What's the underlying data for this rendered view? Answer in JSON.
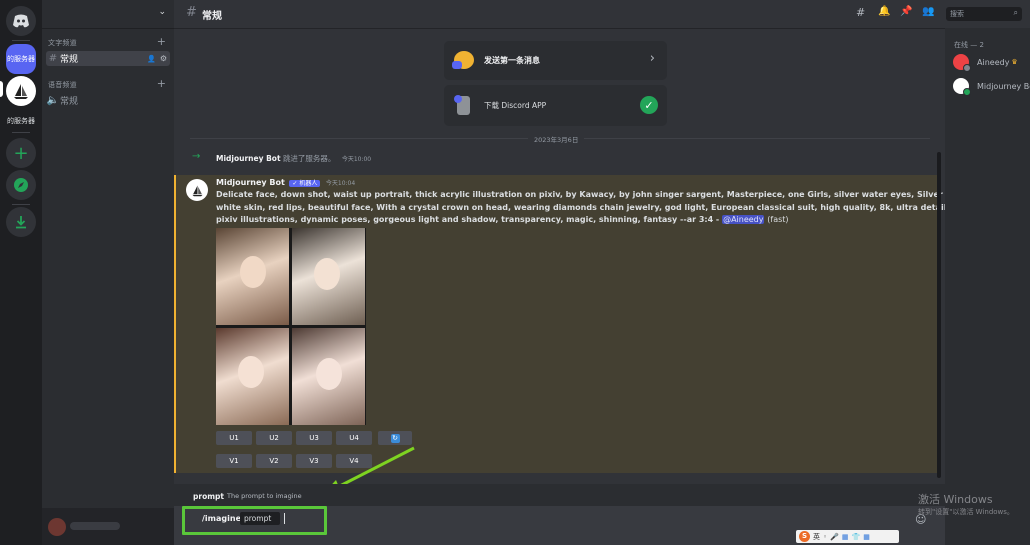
{
  "app": {
    "name": "Discord"
  },
  "servers": [
    {
      "label": "的服务器",
      "color": "#5865f2"
    },
    {
      "label": "的服务器",
      "color": "#ffffff"
    }
  ],
  "rail_icons": [
    "discord-home-icon",
    "add-server-icon",
    "explore-icon",
    "download-icon"
  ],
  "sidebar": {
    "text_category": "文字频道",
    "voice_category": "语音频道",
    "text_channel": "常规",
    "voice_channel": "常规"
  },
  "header": {
    "channel_name": "常规",
    "search_placeholder": "搜索"
  },
  "welcome_cards": [
    {
      "label": "发送第一条消息",
      "trailing": "›"
    },
    {
      "label": "下载 Discord APP",
      "trailing": "✓"
    }
  ],
  "date_divider": "2023年3月6日",
  "join_message": {
    "arrow": "→",
    "author": "Midjourney Bot",
    "text": "跳进了服务器。",
    "time": "今天10:00"
  },
  "bot_message": {
    "author": "Midjourney Bot",
    "badge": "✓ 机器人",
    "time": "今天10:04",
    "prompt_lines": [
      "Delicate face, down shot, waist up portrait, thick acrylic illustration on pixiv, by Kawacy, by john singer sargent, Masterpiece, one Girls, silver water eyes, Silver hair, pale",
      "white skin, red lips, beautiful face, With a crystal crown on head, wearing diamonds chain jewelry, god light, European classical suit, high quality, 8k, ultra detailed, the latest",
      "pixiv illustrations, dynamic poses, gorgeous light and shadow, transparency, magic, shinning, fantasy --ar 3:4 -"
    ],
    "mention": "@Aineedy",
    "speed": "(fast)",
    "upscale_buttons": [
      "U1",
      "U2",
      "U3",
      "U4"
    ],
    "variation_buttons": [
      "V1",
      "V2",
      "V3",
      "V4"
    ],
    "reroll_icon": "refresh-icon"
  },
  "command_hint": {
    "name": "prompt",
    "description": "The prompt to imagine"
  },
  "composer": {
    "command": "/imagine",
    "option": "prompt"
  },
  "members": {
    "header": "在线 — 2",
    "list": [
      {
        "name": "Aineedy",
        "badge": "crown-icon",
        "color": "#ed4245"
      },
      {
        "name": "Midjourney Bot",
        "badge": "",
        "color": "#ffffff"
      }
    ]
  },
  "watermark": {
    "line1": "激活 Windows",
    "line2": "转到\"设置\"以激活 Windows。"
  },
  "ime_toolbar": {
    "logo": "S",
    "lang": "英"
  },
  "colors": {
    "accent": "#5865f2",
    "highlight": "#57f287",
    "arrow_green": "#7ed321",
    "mention_bg": "#4752c4"
  }
}
